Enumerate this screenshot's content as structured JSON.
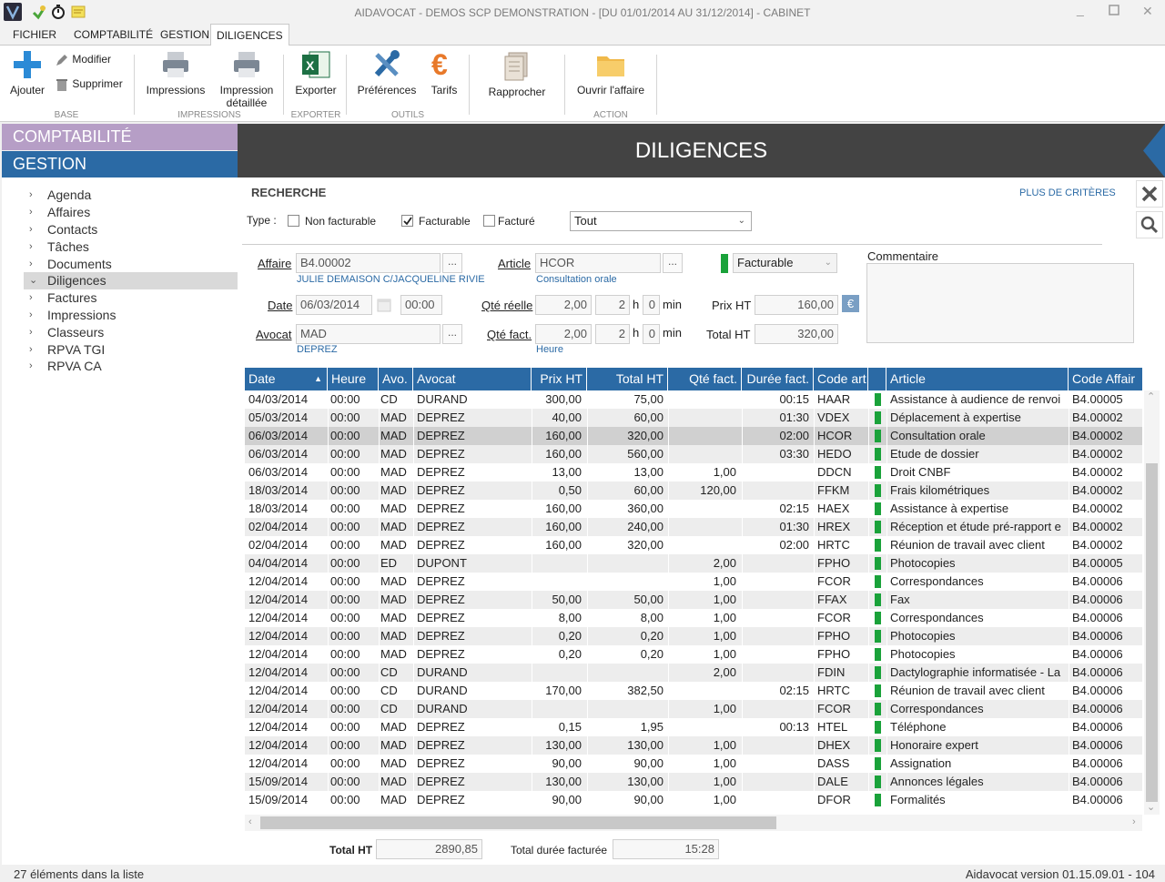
{
  "window": {
    "title": "AIDAVOCAT - DEMOS SCP DEMONSTRATION - [DU 01/01/2014 AU 31/12/2014] - CABINET"
  },
  "menu": {
    "tabs": [
      "FICHIER",
      "COMPTABILITÉ",
      "GESTION",
      "DILIGENCES"
    ],
    "active": "DILIGENCES"
  },
  "ribbon": {
    "ajouter": "Ajouter",
    "modifier": "Modifier",
    "supprimer": "Supprimer",
    "impressions": "Impressions",
    "impression_detaillee_1": "Impression",
    "impression_detaillee_2": "détaillée",
    "exporter": "Exporter",
    "preferences": "Préférences",
    "tarifs": "Tarifs",
    "rapprocher": "Rapprocher",
    "ouvrir_affaire": "Ouvrir l'affaire",
    "groups": {
      "base": "BASE",
      "impressions": "IMPRESSIONS",
      "exporter": "EXPORTER",
      "outils": "OUTILS",
      "action": "ACTION"
    }
  },
  "nav": {
    "comptabilite": "COMPTABILITÉ",
    "gestion": "GESTION",
    "items": [
      "Agenda",
      "Affaires",
      "Contacts",
      "Tâches",
      "Documents",
      "Diligences",
      "Factures",
      "Impressions",
      "Classeurs",
      "RPVA TGI",
      "RPVA CA"
    ],
    "selected": "Diligences"
  },
  "header": {
    "title": "DILIGENCES"
  },
  "search": {
    "title": "RECHERCHE",
    "more": "PLUS DE CRITÈRES",
    "type_label": "Type :",
    "non_facturable": "Non facturable",
    "facturable": "Facturable",
    "facture": "Facturé",
    "select_value": "Tout",
    "checked": {
      "non_facturable": false,
      "facturable": true,
      "facture": false
    }
  },
  "form": {
    "affaire_label": "Affaire",
    "affaire_value": "B4.00002",
    "affaire_sub": "JULIE DEMAISON C/JACQUELINE RIVIE",
    "article_label": "Article",
    "article_value": "HCOR",
    "article_sub": "Consultation orale",
    "status_value": "Facturable",
    "commentaire_label": "Commentaire",
    "date_label": "Date",
    "date_value": "06/03/2014",
    "time_value": "00:00",
    "qte_reelle_label": "Qté réelle",
    "qte_reelle_value": "2,00",
    "qte_reelle_h": "2",
    "qte_reelle_min": "0",
    "prix_ht_label": "Prix HT",
    "prix_ht_value": "160,00",
    "avocat_label": "Avocat",
    "avocat_value": "MAD",
    "avocat_sub": "DEPREZ",
    "qte_fact_label": "Qté fact.",
    "qte_fact_value": "2,00",
    "qte_fact_h": "2",
    "qte_fact_min": "0",
    "qte_fact_sub": "Heure",
    "total_ht_label": "Total HT",
    "total_ht_value": "320,00",
    "h": "h",
    "min": "min",
    "ellipsis": "...",
    "euro": "€"
  },
  "grid": {
    "columns": [
      "Date",
      "Heure",
      "Avo.",
      "Avocat",
      "Prix HT",
      "Total HT",
      "Qté fact.",
      "Durée fact.",
      "Code art",
      "",
      "Article",
      "Code Affair"
    ],
    "selected_row": 2,
    "rows": [
      [
        "04/03/2014",
        "00:00",
        "CD",
        "DURAND",
        "300,00",
        "75,00",
        "",
        "00:15",
        "HAAR",
        "Assistance à audience de renvoi",
        "B4.00005"
      ],
      [
        "05/03/2014",
        "00:00",
        "MAD",
        "DEPREZ",
        "40,00",
        "60,00",
        "",
        "01:30",
        "VDEX",
        "Déplacement à expertise",
        "B4.00002"
      ],
      [
        "06/03/2014",
        "00:00",
        "MAD",
        "DEPREZ",
        "160,00",
        "320,00",
        "",
        "02:00",
        "HCOR",
        "Consultation orale",
        "B4.00002"
      ],
      [
        "06/03/2014",
        "00:00",
        "MAD",
        "DEPREZ",
        "160,00",
        "560,00",
        "",
        "03:30",
        "HEDO",
        "Etude de dossier",
        "B4.00002"
      ],
      [
        "06/03/2014",
        "00:00",
        "MAD",
        "DEPREZ",
        "13,00",
        "13,00",
        "1,00",
        "",
        "DDCN",
        "Droit CNBF",
        "B4.00002"
      ],
      [
        "18/03/2014",
        "00:00",
        "MAD",
        "DEPREZ",
        "0,50",
        "60,00",
        "120,00",
        "",
        "FFKM",
        "Frais kilométriques",
        "B4.00002"
      ],
      [
        "18/03/2014",
        "00:00",
        "MAD",
        "DEPREZ",
        "160,00",
        "360,00",
        "",
        "02:15",
        "HAEX",
        "Assistance à expertise",
        "B4.00002"
      ],
      [
        "02/04/2014",
        "00:00",
        "MAD",
        "DEPREZ",
        "160,00",
        "240,00",
        "",
        "01:30",
        "HREX",
        "Réception et étude pré-rapport e",
        "B4.00002"
      ],
      [
        "02/04/2014",
        "00:00",
        "MAD",
        "DEPREZ",
        "160,00",
        "320,00",
        "",
        "02:00",
        "HRTC",
        "Réunion de travail avec client",
        "B4.00002"
      ],
      [
        "04/04/2014",
        "00:00",
        "ED",
        "DUPONT",
        "",
        "",
        "2,00",
        "",
        "FPHO",
        "Photocopies",
        "B4.00005"
      ],
      [
        "12/04/2014",
        "00:00",
        "MAD",
        "DEPREZ",
        "",
        "",
        "1,00",
        "",
        "FCOR",
        "Correspondances",
        "B4.00006"
      ],
      [
        "12/04/2014",
        "00:00",
        "MAD",
        "DEPREZ",
        "50,00",
        "50,00",
        "1,00",
        "",
        "FFAX",
        "Fax",
        "B4.00006"
      ],
      [
        "12/04/2014",
        "00:00",
        "MAD",
        "DEPREZ",
        "8,00",
        "8,00",
        "1,00",
        "",
        "FCOR",
        "Correspondances",
        "B4.00006"
      ],
      [
        "12/04/2014",
        "00:00",
        "MAD",
        "DEPREZ",
        "0,20",
        "0,20",
        "1,00",
        "",
        "FPHO",
        "Photocopies",
        "B4.00006"
      ],
      [
        "12/04/2014",
        "00:00",
        "MAD",
        "DEPREZ",
        "0,20",
        "0,20",
        "1,00",
        "",
        "FPHO",
        "Photocopies",
        "B4.00006"
      ],
      [
        "12/04/2014",
        "00:00",
        "CD",
        "DURAND",
        "",
        "",
        "2,00",
        "",
        "FDIN",
        "Dactylographie informatisée - La",
        "B4.00006"
      ],
      [
        "12/04/2014",
        "00:00",
        "CD",
        "DURAND",
        "170,00",
        "382,50",
        "",
        "02:15",
        "HRTC",
        "Réunion de travail avec client",
        "B4.00006"
      ],
      [
        "12/04/2014",
        "00:00",
        "CD",
        "DURAND",
        "",
        "",
        "1,00",
        "",
        "FCOR",
        "Correspondances",
        "B4.00006"
      ],
      [
        "12/04/2014",
        "00:00",
        "MAD",
        "DEPREZ",
        "0,15",
        "1,95",
        "",
        "00:13",
        "HTEL",
        "Téléphone",
        "B4.00006"
      ],
      [
        "12/04/2014",
        "00:00",
        "MAD",
        "DEPREZ",
        "130,00",
        "130,00",
        "1,00",
        "",
        "DHEX",
        "Honoraire expert",
        "B4.00006"
      ],
      [
        "12/04/2014",
        "00:00",
        "MAD",
        "DEPREZ",
        "90,00",
        "90,00",
        "1,00",
        "",
        "DASS",
        "Assignation",
        "B4.00006"
      ],
      [
        "15/09/2014",
        "00:00",
        "MAD",
        "DEPREZ",
        "130,00",
        "130,00",
        "1,00",
        "",
        "DALE",
        "Annonces légales",
        "B4.00006"
      ],
      [
        "15/09/2014",
        "00:00",
        "MAD",
        "DEPREZ",
        "90,00",
        "90,00",
        "1,00",
        "",
        "DFOR",
        "Formalités",
        "B4.00006"
      ]
    ]
  },
  "totals": {
    "total_ht_label": "Total HT",
    "total_ht_value": "2890,85",
    "duree_label": "Total durée facturée",
    "duree_value": "15:28"
  },
  "status": {
    "left": "27 éléments dans la liste",
    "right": "Aidavocat version 01.15.09.01 - 104"
  },
  "colors": {
    "accent_blue": "#2b6aa5",
    "purple": "#b69ec6",
    "header_dark": "#434343",
    "facturable_green": "#1aa23a"
  }
}
